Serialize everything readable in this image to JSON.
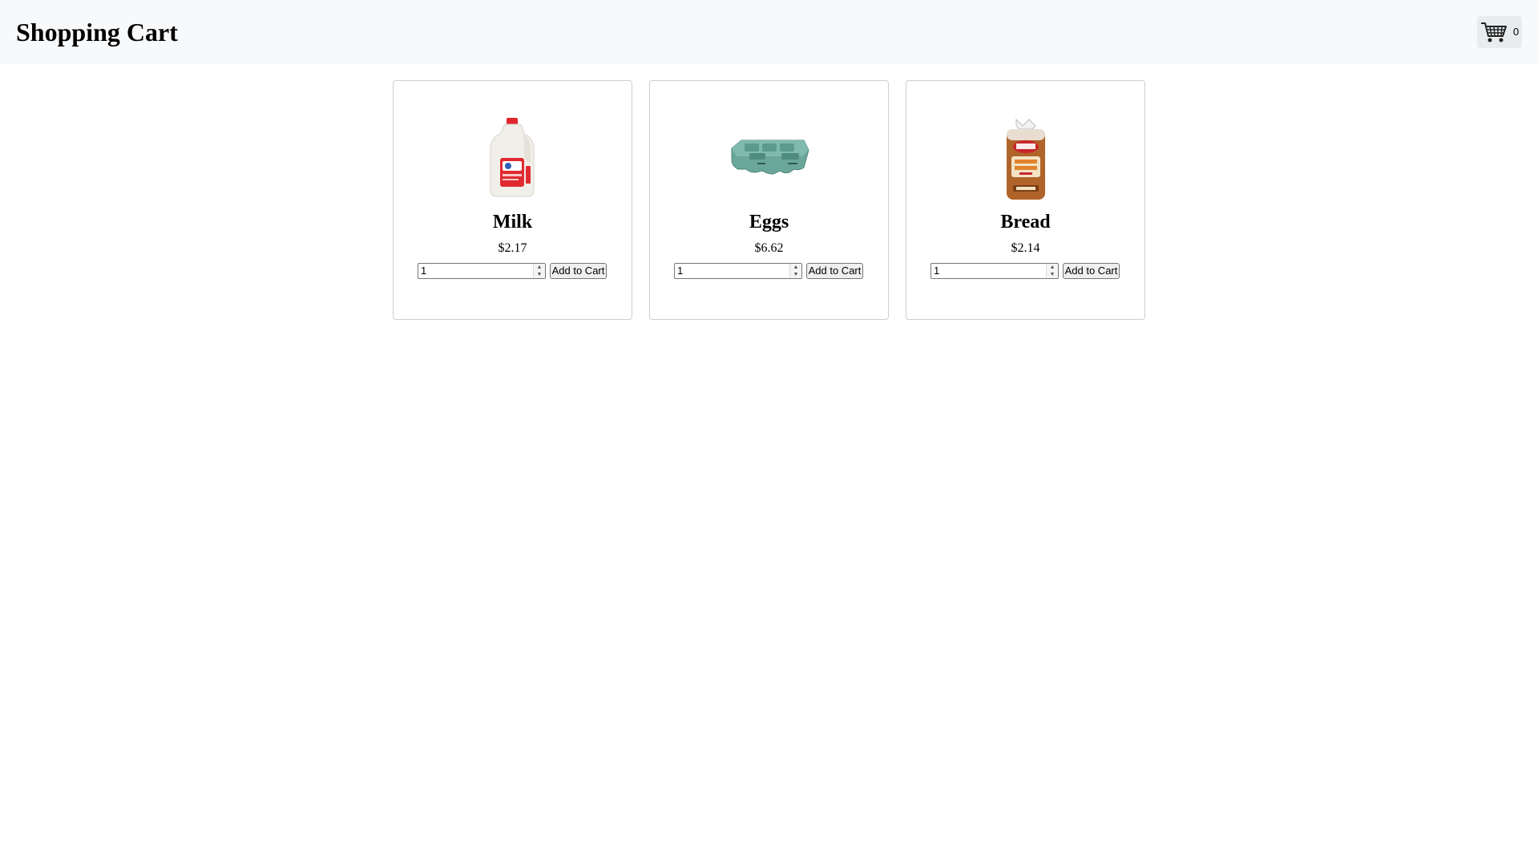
{
  "header": {
    "title": "Shopping Cart",
    "cart_icon": "shopping-cart-icon",
    "cart_count": "0"
  },
  "products": [
    {
      "name": "Milk",
      "price": "$2.17",
      "quantity": "1",
      "add_label": "Add to Cart",
      "image": "milk-jug-image"
    },
    {
      "name": "Eggs",
      "price": "$6.62",
      "quantity": "1",
      "add_label": "Add to Cart",
      "image": "egg-carton-image"
    },
    {
      "name": "Bread",
      "price": "$2.14",
      "quantity": "1",
      "add_label": "Add to Cart",
      "image": "bread-loaf-image"
    }
  ],
  "colors": {
    "header_bg": "#f8f9fa",
    "card_border": "#cfcfcf"
  }
}
